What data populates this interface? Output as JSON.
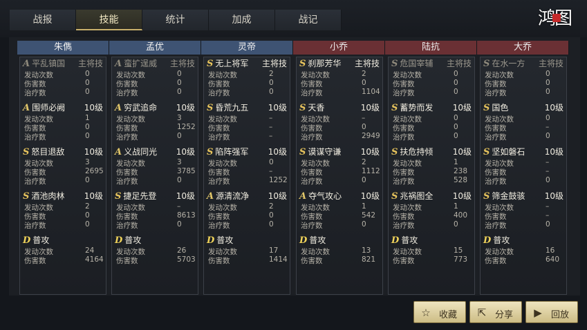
{
  "tabs": [
    "战报",
    "技能",
    "统计",
    "加成",
    "战记"
  ],
  "active_tab": 1,
  "logo": "鸿图",
  "stat_labels": {
    "launches": "发动次数",
    "damage": "伤害数",
    "heal": "治疗数"
  },
  "buttons": {
    "favorite": "收藏",
    "share": "分享",
    "replay": "回放"
  },
  "generals": [
    {
      "name": "朱儁",
      "side": "blue",
      "skills": [
        {
          "grade": "A",
          "name": "平乱镇国",
          "level": "主将技",
          "dim": true,
          "launches": "0",
          "damage": "0",
          "heal": "0"
        },
        {
          "grade": "A",
          "name": "围师必阙",
          "level": "10级",
          "launches": "1",
          "damage": "0",
          "heal": "0"
        },
        {
          "grade": "S",
          "name": "怒目退敌",
          "level": "10级",
          "launches": "3",
          "damage": "2695",
          "heal": "0"
        },
        {
          "grade": "S",
          "name": "酒池肉林",
          "level": "10级",
          "launches": "2",
          "damage": "0",
          "heal": "0"
        },
        {
          "grade": "D",
          "name": "普攻",
          "level": "",
          "launches": "24",
          "damage": "4164"
        }
      ]
    },
    {
      "name": "孟优",
      "side": "blue",
      "skills": [
        {
          "grade": "A",
          "name": "蛮扩逞威",
          "level": "主将技",
          "dim": true,
          "launches": "0",
          "damage": "0",
          "heal": "0"
        },
        {
          "grade": "A",
          "name": "穷武追命",
          "level": "10级",
          "launches": "3",
          "damage": "1252",
          "heal": "0"
        },
        {
          "grade": "A",
          "name": "义战同光",
          "level": "10级",
          "launches": "3",
          "damage": "3785",
          "heal": "0"
        },
        {
          "grade": "S",
          "name": "捷足先登",
          "level": "10级",
          "launches": "–",
          "damage": "8613",
          "heal": "0"
        },
        {
          "grade": "D",
          "name": "普攻",
          "level": "",
          "launches": "26",
          "damage": "5703"
        }
      ]
    },
    {
      "name": "灵帝",
      "side": "blue",
      "skills": [
        {
          "grade": "S",
          "name": "无上将军",
          "level": "主将技",
          "launches": "2",
          "damage": "0",
          "heal": "0"
        },
        {
          "grade": "S",
          "name": "昏荒九五",
          "level": "10级",
          "launches": "–",
          "damage": "–",
          "heal": "–"
        },
        {
          "grade": "S",
          "name": "陷阵强军",
          "level": "10级",
          "launches": "0",
          "damage": "–",
          "heal": "1252"
        },
        {
          "grade": "A",
          "name": "源清流净",
          "level": "10级",
          "launches": "2",
          "damage": "0",
          "heal": "0"
        },
        {
          "grade": "D",
          "name": "普攻",
          "level": "",
          "launches": "17",
          "damage": "1414"
        }
      ]
    },
    {
      "name": "小乔",
      "side": "red",
      "skills": [
        {
          "grade": "S",
          "name": "刹那芳华",
          "level": "主将技",
          "launches": "2",
          "damage": "0",
          "heal": "1104"
        },
        {
          "grade": "S",
          "name": "天香",
          "level": "10级",
          "launches": "–",
          "damage": "0",
          "heal": "2949"
        },
        {
          "grade": "S",
          "name": "谟谋守谦",
          "level": "10级",
          "launches": "2",
          "damage": "1112",
          "heal": "0"
        },
        {
          "grade": "A",
          "name": "夺气攻心",
          "level": "10级",
          "launches": "1",
          "damage": "542",
          "heal": "0"
        },
        {
          "grade": "D",
          "name": "普攻",
          "level": "",
          "launches": "13",
          "damage": "821"
        }
      ]
    },
    {
      "name": "陆抗",
      "side": "red",
      "skills": [
        {
          "grade": "S",
          "name": "危国宰辅",
          "level": "主将技",
          "dim": true,
          "launches": "0",
          "damage": "0",
          "heal": "0"
        },
        {
          "grade": "S",
          "name": "蓄势而发",
          "level": "10级",
          "launches": "0",
          "damage": "0",
          "heal": "0"
        },
        {
          "grade": "S",
          "name": "扶危持倾",
          "level": "10级",
          "launches": "1",
          "damage": "238",
          "heal": "528"
        },
        {
          "grade": "S",
          "name": "兆祸图全",
          "level": "10级",
          "launches": "1",
          "damage": "400",
          "heal": "0"
        },
        {
          "grade": "D",
          "name": "普攻",
          "level": "",
          "launches": "15",
          "damage": "773"
        }
      ]
    },
    {
      "name": "大乔",
      "side": "red",
      "skills": [
        {
          "grade": "S",
          "name": "在水一方",
          "level": "主将技",
          "dim": true,
          "launches": "0",
          "damage": "0",
          "heal": "0"
        },
        {
          "grade": "S",
          "name": "国色",
          "level": "10级",
          "launches": "0",
          "damage": "–",
          "heal": "0"
        },
        {
          "grade": "S",
          "name": "坚如磐石",
          "level": "10级",
          "launches": "–",
          "damage": "–",
          "heal": "0"
        },
        {
          "grade": "S",
          "name": "筛金鼓骇",
          "level": "10级",
          "launches": "–",
          "damage": "–",
          "heal": "0"
        },
        {
          "grade": "D",
          "name": "普攻",
          "level": "",
          "launches": "16",
          "damage": "640"
        }
      ]
    }
  ]
}
